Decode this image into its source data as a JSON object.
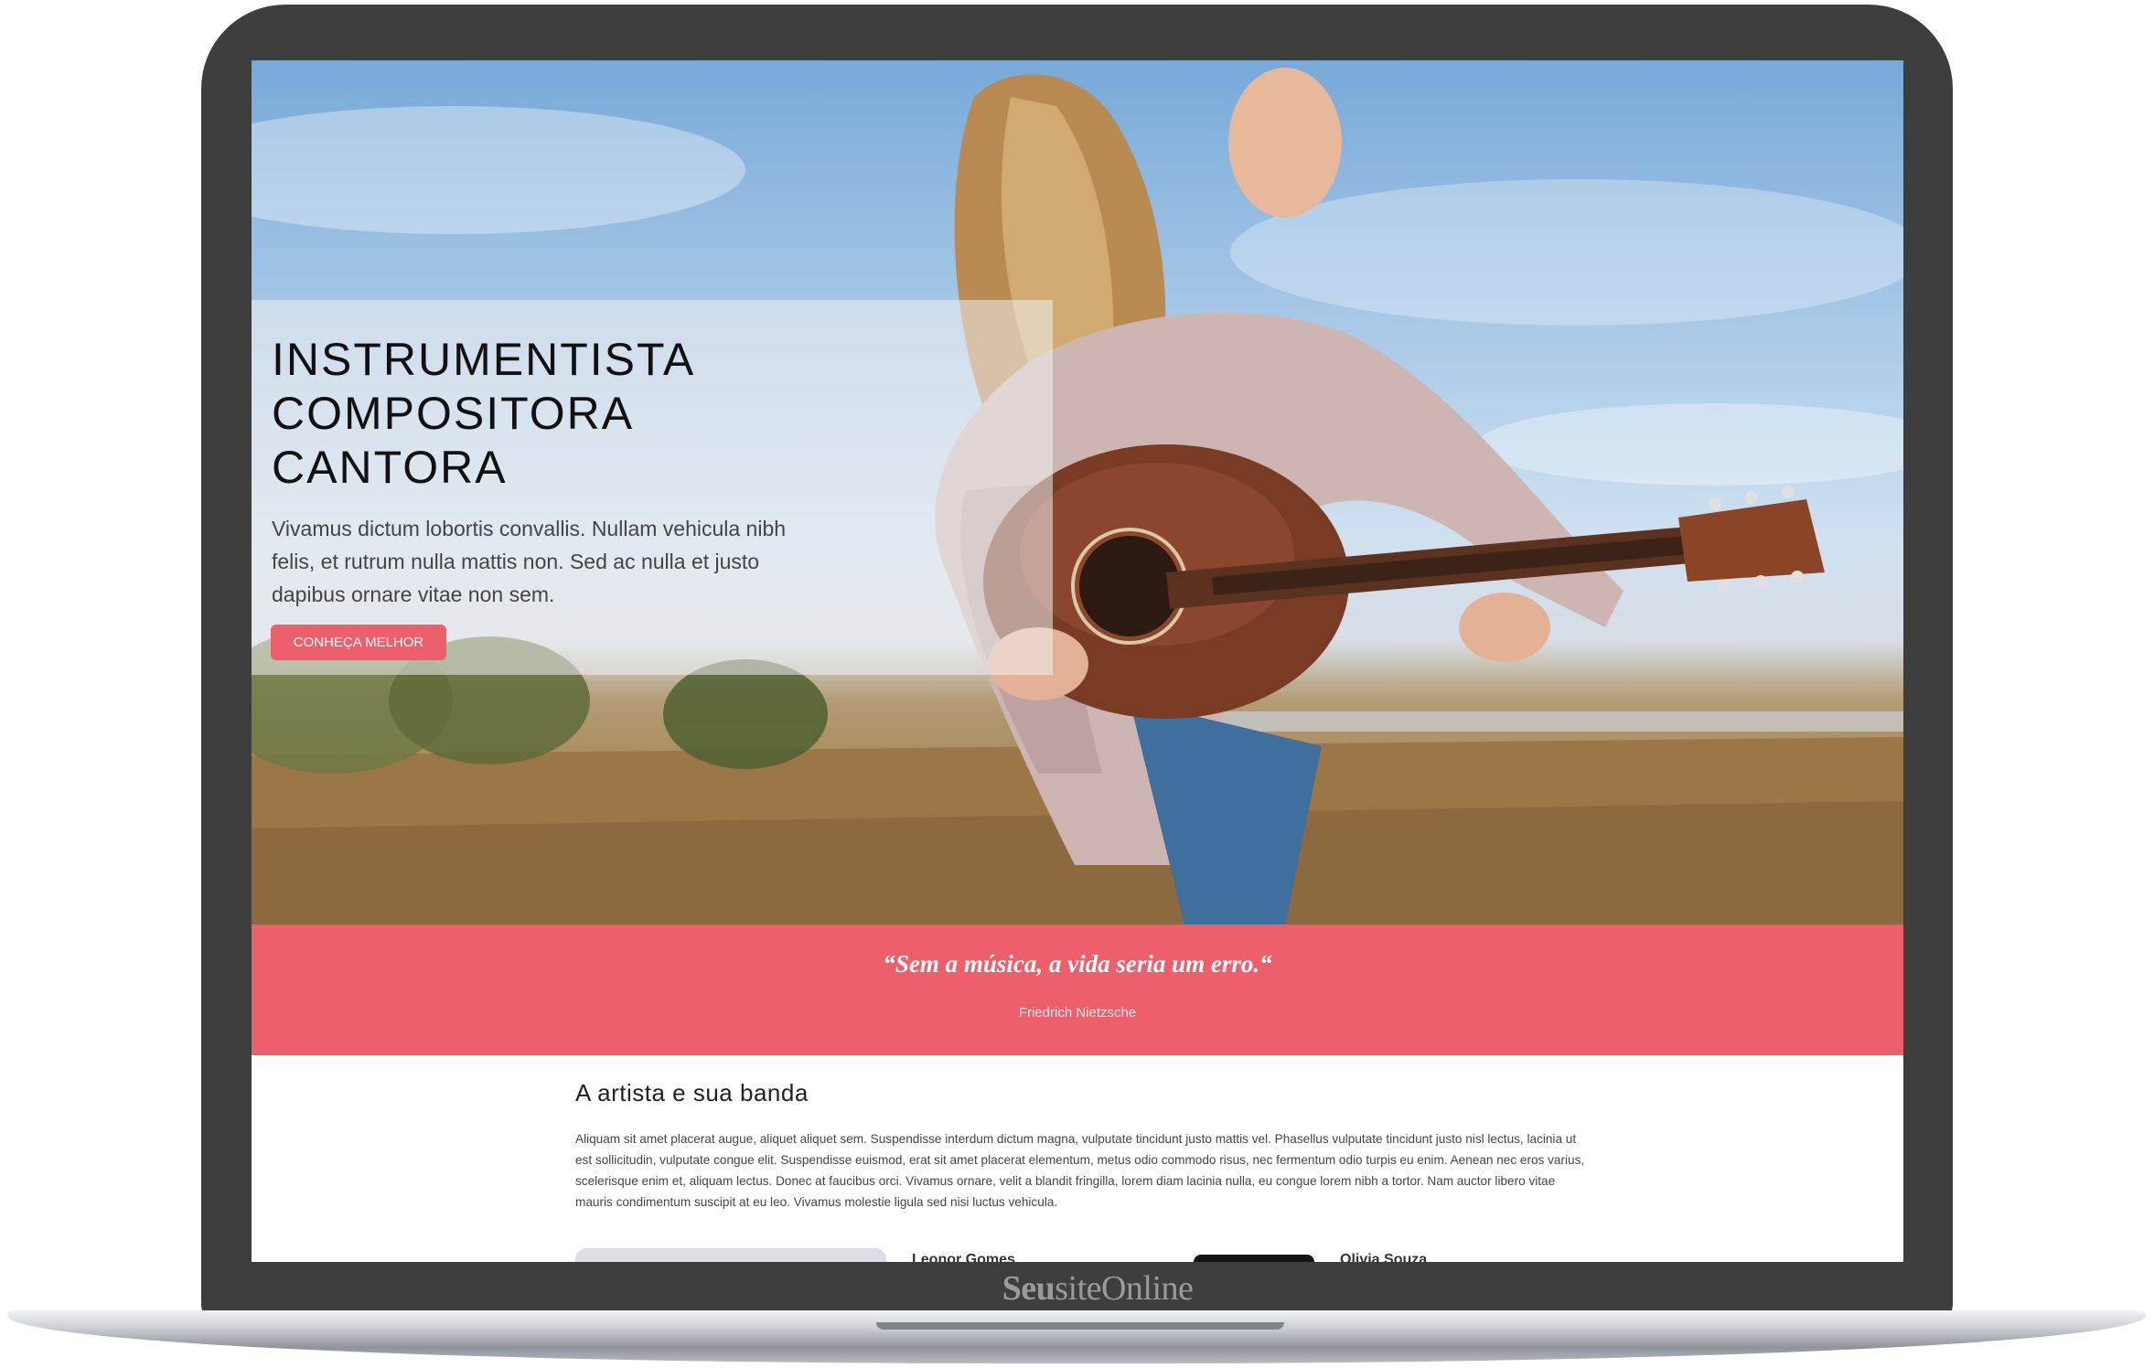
{
  "brand": {
    "bold": "Seu",
    "regular": "siteOnline"
  },
  "hero": {
    "title_lines": [
      "INSTRUMENTISTA",
      "COMPOSITORA",
      "CANTORA"
    ],
    "text": "Vivamus dictum lobortis convallis. Nullam vehicula nibh felis, et rutrum nulla mattis non. Sed ac nulla et justo dapibus ornare vitae non sem.",
    "button_label": "CONHEÇA MELHOR"
  },
  "quote": {
    "text": "“Sem a música, a vida seria um erro.“",
    "author": "Friedrich Nietzsche"
  },
  "about": {
    "title": "A artista e sua banda",
    "text": "Aliquam sit amet placerat augue, aliquet aliquet sem. Suspendisse interdum dictum magna, vulputate tincidunt justo mattis vel. Phasellus vulputate tincidunt justo nisl lectus, lacinia ut est sollicitudin, vulputate congue elit. Suspendisse euismod, erat sit amet placerat elementum, metus odio commodo risus, nec fermentum odio turpis eu enim. Aenean nec eros varius, scelerisque enim et, aliquam lectus. Donec at faucibus orci. Vivamus ornare, velit a blandit fringilla, lorem diam lacinia nulla, eu congue lorem nibh a tortor. Nam auctor libero vitae mauris condimentum suscipit at eu leo. Vivamus molestie ligula sed nisi luctus vehicula."
  },
  "snippets": [
    "Leonor Gomes",
    "Olivia Souza"
  ],
  "colors": {
    "accent": "#ec5f6b",
    "bezel": "#3e3e3e"
  }
}
